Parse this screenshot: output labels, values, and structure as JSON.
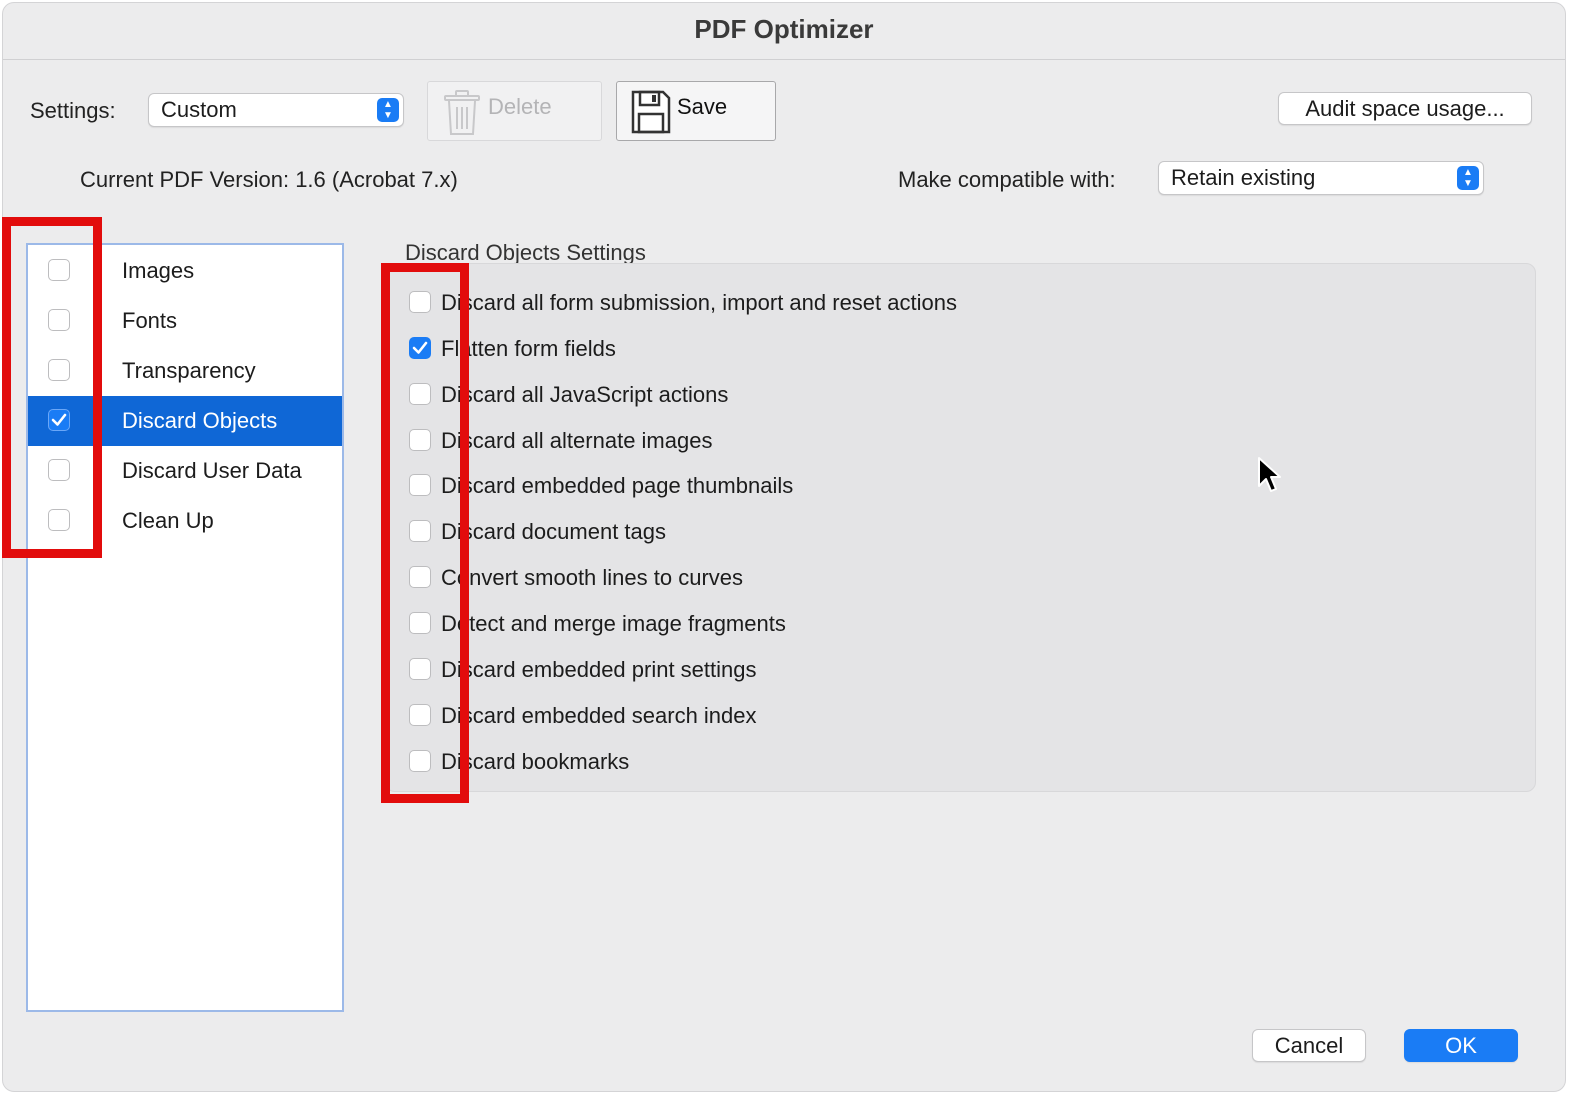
{
  "window": {
    "title": "PDF Optimizer"
  },
  "settings": {
    "label": "Settings:",
    "value": "Custom",
    "delete_label": "Delete",
    "save_label": "Save",
    "audit_label": "Audit space usage..."
  },
  "version": {
    "current": "Current PDF Version: 1.6 (Acrobat 7.x)",
    "compat_label": "Make compatible with:",
    "compat_value": "Retain existing"
  },
  "categories": [
    {
      "label": "Images",
      "checked": false,
      "selected": false
    },
    {
      "label": "Fonts",
      "checked": false,
      "selected": false
    },
    {
      "label": "Transparency",
      "checked": false,
      "selected": false
    },
    {
      "label": "Discard Objects",
      "checked": true,
      "selected": true
    },
    {
      "label": "Discard User Data",
      "checked": false,
      "selected": false
    },
    {
      "label": "Clean Up",
      "checked": false,
      "selected": false
    }
  ],
  "discard_objects": {
    "title": "Discard Objects Settings",
    "options": [
      {
        "label": "Discard all form submission, import and reset actions",
        "checked": false
      },
      {
        "label": "Flatten form fields",
        "checked": true
      },
      {
        "label": "Discard all JavaScript actions",
        "checked": false
      },
      {
        "label": "Discard all alternate images",
        "checked": false
      },
      {
        "label": "Discard embedded page thumbnails",
        "checked": false
      },
      {
        "label": "Discard document tags",
        "checked": false
      },
      {
        "label": "Convert smooth lines to curves",
        "checked": false
      },
      {
        "label": "Detect and merge image fragments",
        "checked": false
      },
      {
        "label": "Discard embedded print settings",
        "checked": false
      },
      {
        "label": "Discard embedded search index",
        "checked": false
      },
      {
        "label": "Discard bookmarks",
        "checked": false
      }
    ]
  },
  "footer": {
    "cancel_label": "Cancel",
    "ok_label": "OK"
  },
  "colors": {
    "accent": "#1a7cf5",
    "highlight": "#e20c0c",
    "selection": "#0f67d6"
  }
}
